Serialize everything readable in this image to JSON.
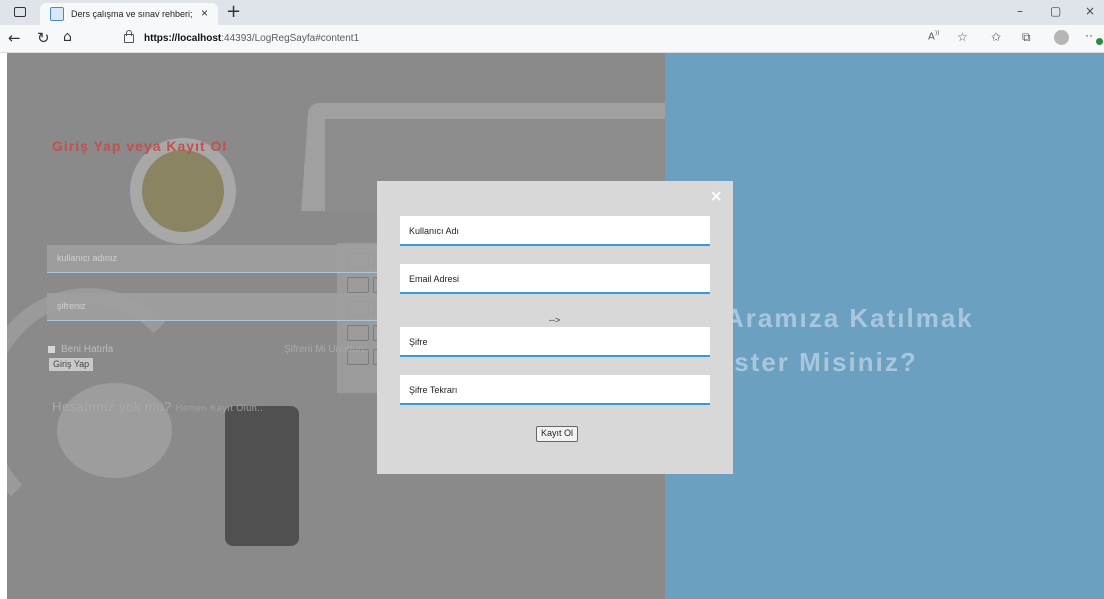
{
  "browser": {
    "tab_title": "Ders çalışma ve sınav rehberi;",
    "tab_close": "×",
    "new_tab": "+",
    "url_host": "https://localhost",
    "url_rest": ":44393/LogRegSayfa#content1",
    "window_controls": [
      "–",
      "▢",
      "×"
    ]
  },
  "login": {
    "title": "Giriş Yap veya Kayıt Ol",
    "username_placeholder": "kullanıcı adınız",
    "password_placeholder": "şifreniz",
    "remember_label": "Beni Hatırla",
    "forgot_label": "Şifreni Mi Unuttun..",
    "login_button": "Giriş Yap",
    "no_account_text": "Hesabınız yok mu?",
    "register_link": "Hemen Kayıt Olun.."
  },
  "banner": {
    "line1": "Aramıza Katılmak",
    "line2": "İster Misiniz?"
  },
  "modal": {
    "close_symbol": "×",
    "username_label": "Kullanıcı Adı",
    "email_label": "Email Adresi",
    "stray_text": "-->",
    "password_label": "Şifre",
    "password_repeat_label": "Şifre Tekrarı",
    "submit_button": "Kayıt Ol"
  },
  "colors": {
    "right_panel": "#6ba0c1",
    "field_underline": "#3a9bd5",
    "login_title": "#c34f4f"
  }
}
